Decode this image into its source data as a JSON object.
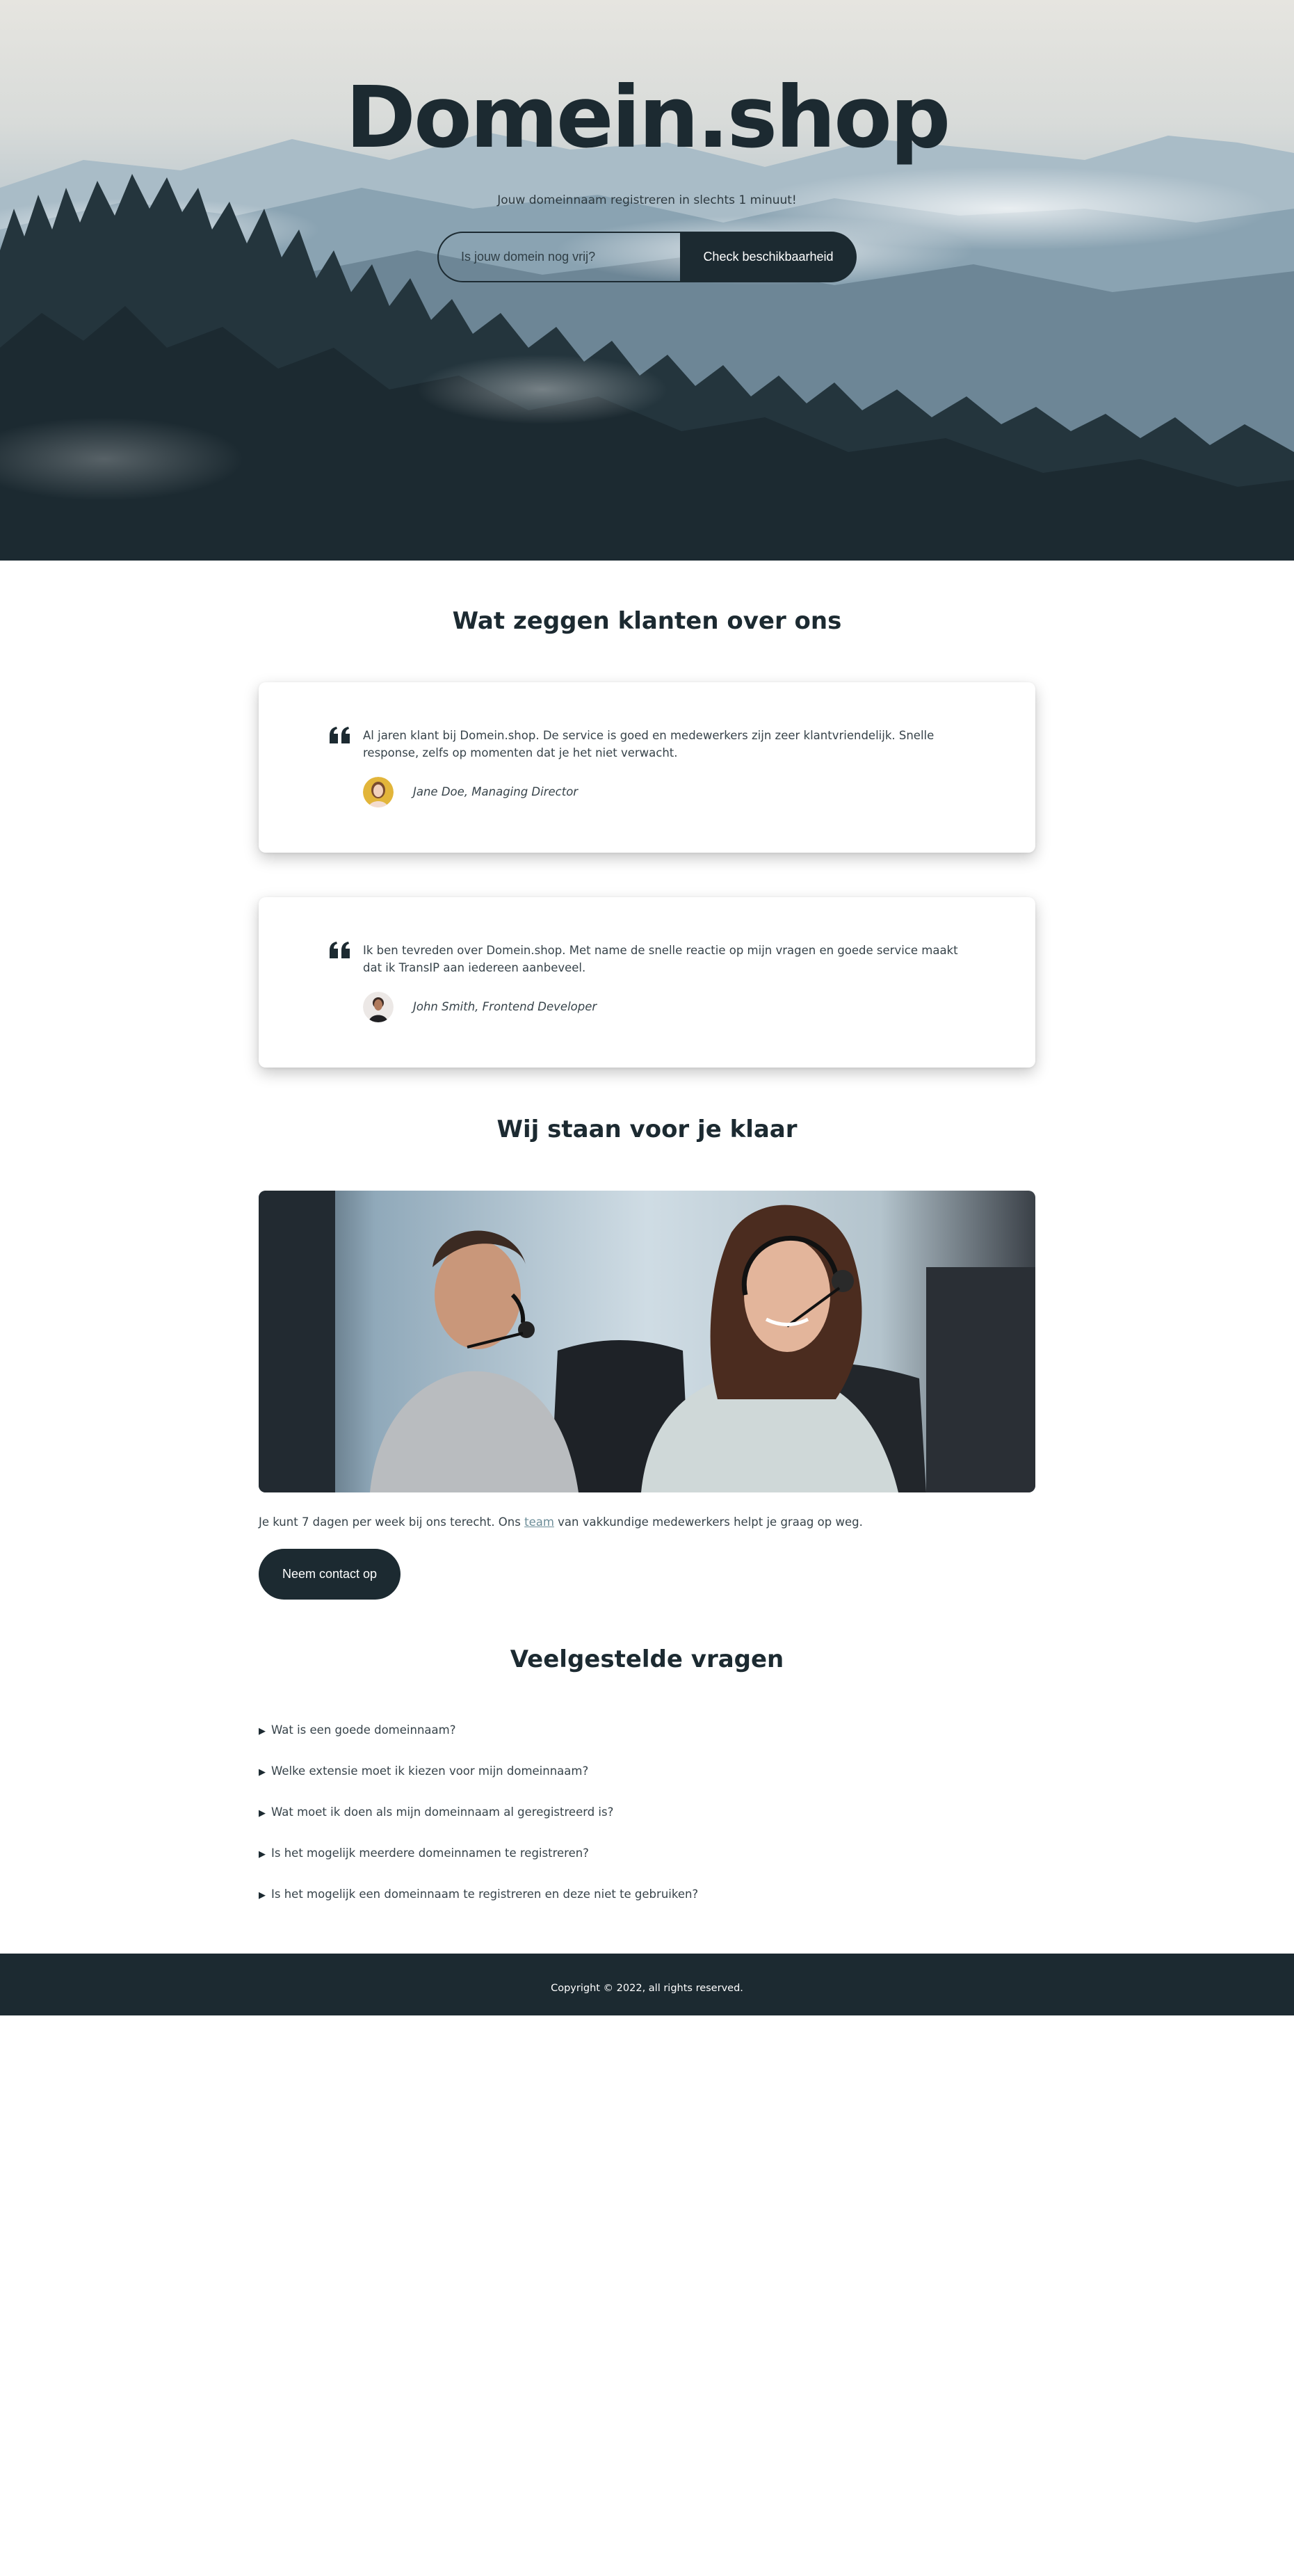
{
  "hero": {
    "title": "Domein.shop",
    "subtitle": "Jouw domeinnaam registreren in slechts 1 minuut!",
    "search_placeholder": "Is jouw domein nog vrij?",
    "search_button": "Check beschikbaarheid"
  },
  "testimonials": {
    "title": "Wat zeggen klanten over ons",
    "items": [
      {
        "text": "Al jaren klant bij Domein.shop. De service is goed en medewerkers zijn zeer klantvriendelijk. Snelle response, zelfs op momenten dat je het niet verwacht.",
        "author": "Jane Doe, Managing Director"
      },
      {
        "text": "Ik ben tevreden over Domein.shop. Met name de snelle reactie op mijn vragen en goede service maakt dat ik TransIP aan iedereen aanbeveel.",
        "author": "John Smith, Frontend Developer"
      }
    ]
  },
  "support": {
    "title": "Wij staan voor je klaar",
    "text_before": "Je kunt 7 dagen per week bij ons terecht. Ons ",
    "link": "team",
    "text_after": " van vakkundige medewerkers helpt je graag op weg.",
    "button": "Neem contact op"
  },
  "faq": {
    "title": "Veelgestelde vragen",
    "items": [
      "Wat is een goede domeinnaam?",
      "Welke extensie moet ik kiezen voor mijn domeinnaam?",
      "Wat moet ik doen als mijn domeinnaam al geregistreerd is?",
      "Is het mogelijk meerdere domeinnamen te registreren?",
      "Is het mogelijk een domeinnaam te registreren en deze niet te gebruiken?"
    ]
  },
  "footer": {
    "copyright": "Copyright © 2022, all rights reserved."
  },
  "colors": {
    "primary": "#1c2a31",
    "text": "#37434a",
    "link": "#6c8d98"
  }
}
